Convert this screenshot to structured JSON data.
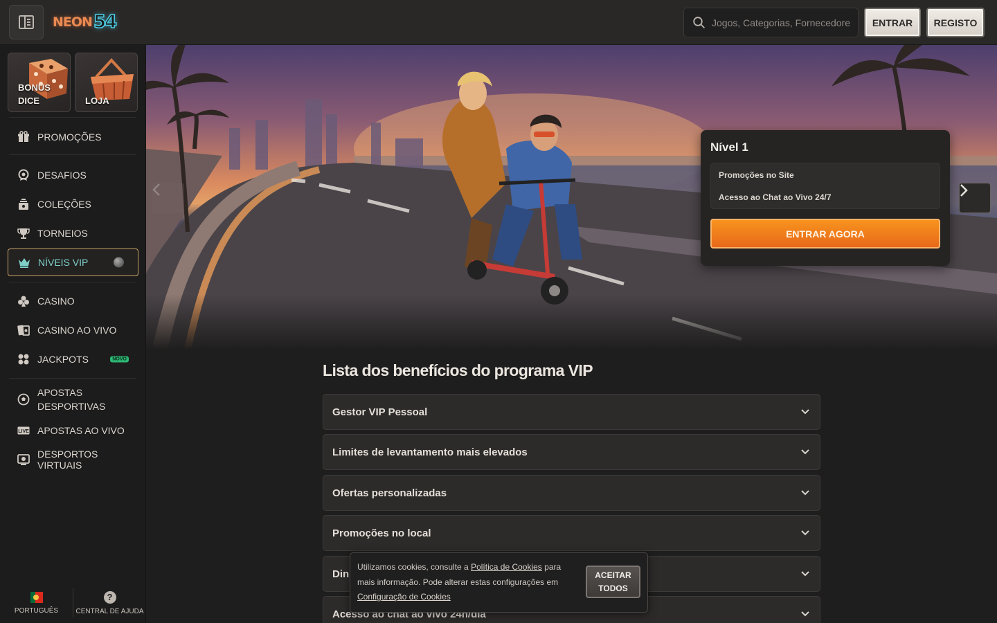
{
  "header": {
    "logo_text": "NEON",
    "logo_number": "54",
    "search_placeholder": "Jogos, Categorias, Fornecedores",
    "login_label": "ENTRAR",
    "register_label": "REGISTO"
  },
  "sidebar": {
    "tiles": [
      {
        "label_line1": "BONUS",
        "label_line2": "DICE"
      },
      {
        "label_line1": "LOJA"
      }
    ],
    "items": [
      {
        "label": "PROMOÇÕES",
        "icon": "gift-icon"
      },
      {
        "label": "DESAFIOS",
        "icon": "target-icon"
      },
      {
        "label": "COLEÇÕES",
        "icon": "collection-icon"
      },
      {
        "label": "TORNEIOS",
        "icon": "trophy-icon"
      },
      {
        "label": "NÍVEIS VIP",
        "icon": "crown-icon",
        "active": true
      },
      {
        "label": "CASINO",
        "icon": "clubs-icon"
      },
      {
        "label": "CASINO AO VIVO",
        "icon": "live-dealer-icon"
      },
      {
        "label": "JACKPOTS",
        "icon": "jackpot-icon",
        "badge": "NOVO"
      },
      {
        "label_line1": "APOSTAS",
        "label_line2": "DESPORTIVAS",
        "icon": "soccer-ball-icon"
      },
      {
        "label": "APOSTAS AO VIVO",
        "icon": "live-icon"
      },
      {
        "label": "DESPORTOS VIRTUAIS",
        "icon": "virtual-sports-icon"
      }
    ],
    "footer": {
      "language": "PORTUGUÊS",
      "help": "CENTRAL DE AJUDA"
    }
  },
  "vip_card": {
    "level": "Nível 1",
    "benefits": [
      "Promoções no Site",
      "Acesso ao Chat ao Vivo 24/7"
    ],
    "cta": "ENTRAR AGORA"
  },
  "benefits_section": {
    "title": "Lista dos benefícios do programa VIP",
    "items": [
      "Gestor VIP Pessoal",
      "Limites de levantamento mais elevados",
      "Ofertas personalizadas",
      "Promoções no local",
      "Dinheiro",
      "Acesso ao chat ao vivo 24h/dia"
    ]
  },
  "cookie_banner": {
    "text_before": "Utilizamos cookies, consulte a ",
    "policy_link": "Política de Cookies",
    "text_middle": " para mais informação. Pode alterar estas configurações em ",
    "settings_link": "Configuração de Cookies",
    "accept_line1": "ACEITAR",
    "accept_line2": "TODOS"
  },
  "colors": {
    "accent_orange": "#f28a1e",
    "vip_active_border": "#c9a46a",
    "vip_active_text": "#7ed0c8",
    "background": "#1f1e1e"
  }
}
